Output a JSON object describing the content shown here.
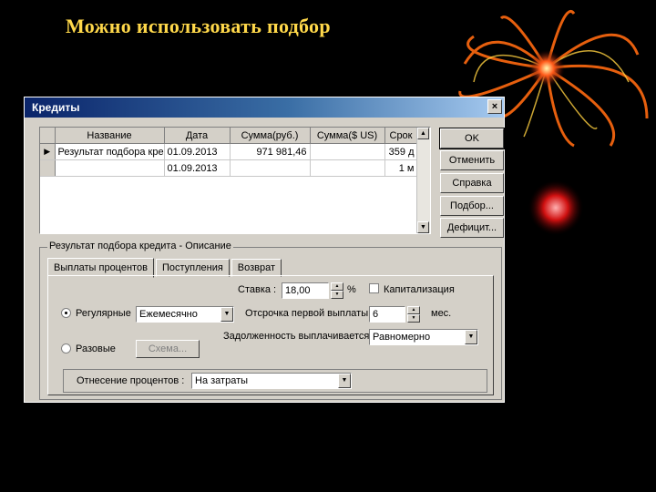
{
  "slide": {
    "title": "Можно использовать подбор"
  },
  "window": {
    "title": "Кредиты",
    "close_label": "×"
  },
  "table": {
    "columns": [
      "Название",
      "Дата",
      "Сумма(руб.)",
      "Сумма($ US)",
      "Срок"
    ],
    "rows": [
      {
        "indicator": "▶",
        "name": "Результат подбора кре",
        "date": "01.09.2013",
        "sum_rub": "971 981,46",
        "sum_usd": "",
        "term": "359 д"
      },
      {
        "indicator": "",
        "name": "",
        "date": "01.09.2013",
        "sum_rub": "",
        "sum_usd": "",
        "term": "1 м"
      }
    ]
  },
  "buttons": {
    "ok": "OK",
    "cancel": "Отменить",
    "help": "Справка",
    "select": "Подбор...",
    "deficit": "Дефицит..."
  },
  "group": {
    "title": "Результат подбора кредита - Описание",
    "tabs": [
      "Выплаты процентов",
      "Поступления",
      "Возврат"
    ]
  },
  "panel": {
    "rate_label": "Ставка :",
    "rate_value": "18,00",
    "percent_sign": "%",
    "capitalization_label": "Капитализация",
    "capitalization_checked": false,
    "regular_label": "Регулярные",
    "regular_checked": true,
    "frequency_value": "Ежемесячно",
    "delay_label": "Отсрочка первой выплаты",
    "delay_value": "6",
    "months_label": "мес.",
    "debt_label": "Задолженность выплачивается",
    "debt_value": "Равномерно",
    "single_label": "Разовые",
    "single_checked": false,
    "scheme_button": "Схема...",
    "interest_label": "Отнесение процентов :",
    "interest_value": "На затраты"
  },
  "colors": {
    "title": "#ffd84a",
    "titlebar": "#0a246a",
    "dialog": "#d4d0c8"
  }
}
